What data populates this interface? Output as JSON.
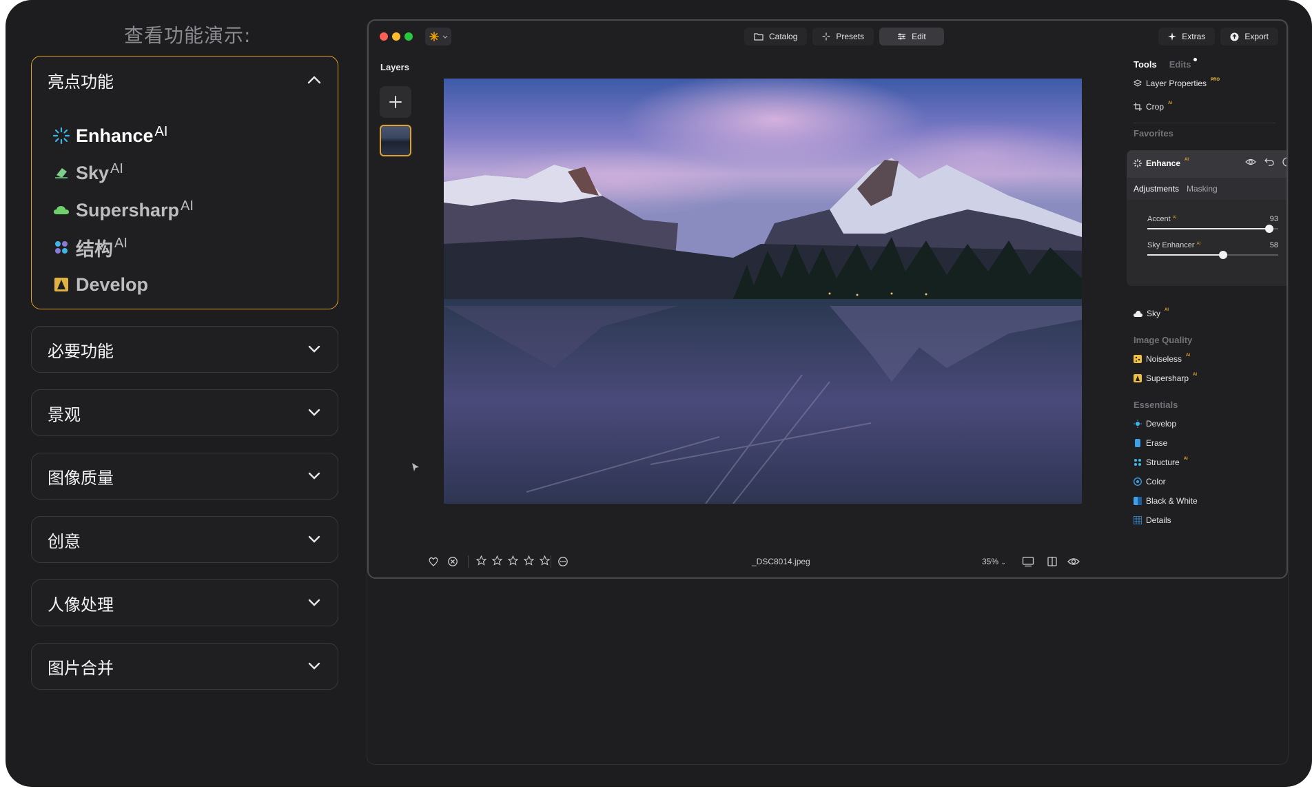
{
  "left": {
    "title": "查看功能演示:",
    "open_section": {
      "label": "亮点功能",
      "features": [
        {
          "name": "Enhance",
          "sup": "AI",
          "icon": "enhance-icon",
          "active": true
        },
        {
          "name": "Sky",
          "sup": "AI",
          "icon": "sky-eraser-icon",
          "active": false
        },
        {
          "name": "Supersharp",
          "sup": "AI",
          "icon": "cloud-icon",
          "active": false
        },
        {
          "name": "结构",
          "sup": "AI",
          "icon": "structure-icon",
          "active": false
        },
        {
          "name": "Develop",
          "sup": "",
          "icon": "develop-icon",
          "active": false
        }
      ]
    },
    "sections": [
      "必要功能",
      "景观",
      "图像质量",
      "创意",
      "人像处理",
      "图片合并"
    ]
  },
  "app": {
    "nav": {
      "catalog": "Catalog",
      "presets": "Presets",
      "edit": "Edit"
    },
    "right_buttons": {
      "extras": "Extras",
      "export": "Export"
    },
    "layers_label": "Layers",
    "filename": "_DSC8014.jpeg",
    "zoom": "35%",
    "rating_stars": 5,
    "panel": {
      "tab_tools": "Tools",
      "tab_edits": "Edits",
      "layer_properties": "Layer Properties",
      "layer_properties_badge": "PRO",
      "crop": "Crop",
      "ai_badge": "AI",
      "favorites": "Favorites",
      "enhance": {
        "title": "Enhance",
        "subtab_adjustments": "Adjustments",
        "subtab_masking": "Masking",
        "sliders": [
          {
            "label": "Accent",
            "value": "93",
            "level": 0.93
          },
          {
            "label": "Sky Enhancer",
            "value": "58",
            "level": 0.58
          }
        ]
      },
      "sky": "Sky",
      "image_quality": "Image Quality",
      "noiseless": "Noiseless",
      "supersharp": "Supersharp",
      "essentials": "Essentials",
      "develop": "Develop",
      "erase": "Erase",
      "structure": "Structure",
      "color": "Color",
      "black_white": "Black & White",
      "details": "Details"
    }
  },
  "colors": {
    "accent": "#e0a32a",
    "page_bg": "#1d1d1f",
    "traffic_red": "#ff5f57",
    "traffic_yellow": "#febc2e",
    "traffic_green": "#28c840"
  }
}
